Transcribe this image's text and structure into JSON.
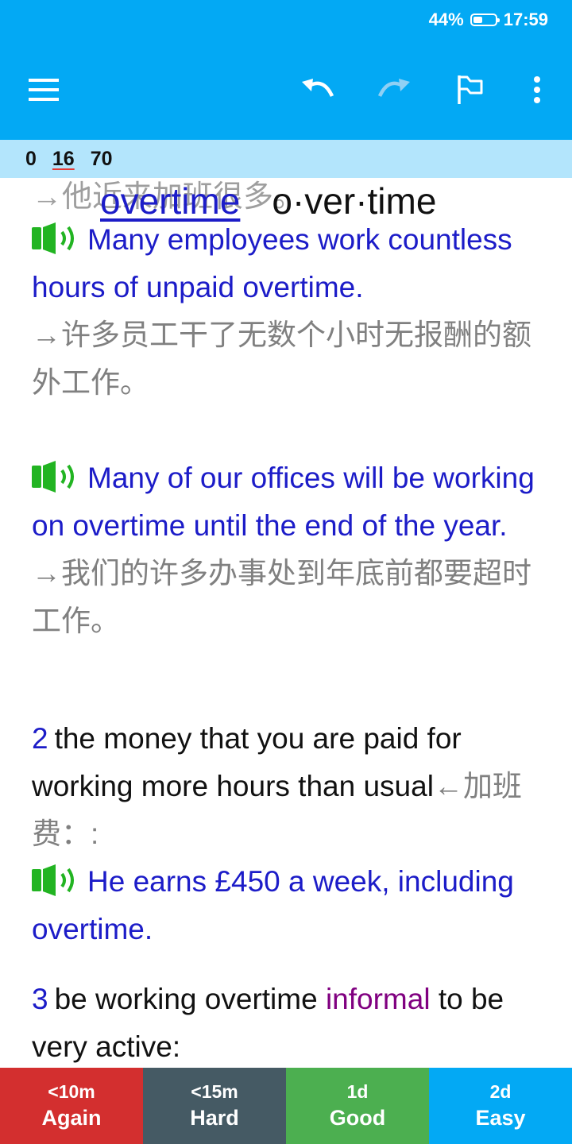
{
  "status": {
    "battery": "44%",
    "battery_level": 0.44,
    "time": "17:59"
  },
  "toolbar": {
    "icons": [
      "menu-icon",
      "undo-icon",
      "redo-icon",
      "flag-icon",
      "more-vert-icon"
    ]
  },
  "counts": {
    "new": "0",
    "learning": "16",
    "review": "70"
  },
  "card": {
    "ghost_text": "→他近来加班很多。",
    "headword": "overtime",
    "syllabification": "o·ver·time",
    "ex1": "Many employees work countless hours of unpaid overtime.",
    "tr1": "→许多员工干了无数个小时无报酬的额外工作。",
    "ex2": "Many of our offices will be working on overtime until the end of the year.",
    "tr2": "→我们的许多办事处到年底前都要超时工作。",
    "sense2": {
      "num": "2",
      "def": "the money that you are paid for working more hours than usual",
      "tr": "←加班费：:"
    },
    "ex3": "He earns £450 a week, including overtime.",
    "sense3": {
      "num": "3",
      "def_a": "be working overtime",
      "label": "informal",
      "def_b": "to be very active:"
    }
  },
  "answers": [
    {
      "interval": "<10m",
      "label": "Again",
      "color": "#d32f2f"
    },
    {
      "interval": "<15m",
      "label": "Hard",
      "color": "#455a64"
    },
    {
      "interval": "1d",
      "label": "Good",
      "color": "#4caf50"
    },
    {
      "interval": "2d",
      "label": "Easy",
      "color": "#03a9f4"
    }
  ],
  "colors": {
    "primary": "#03a9f4",
    "counts_bar": "#b3e5fc",
    "example_text": "#1c1cc8",
    "translation_text": "#808080",
    "label_purple": "#800080"
  }
}
